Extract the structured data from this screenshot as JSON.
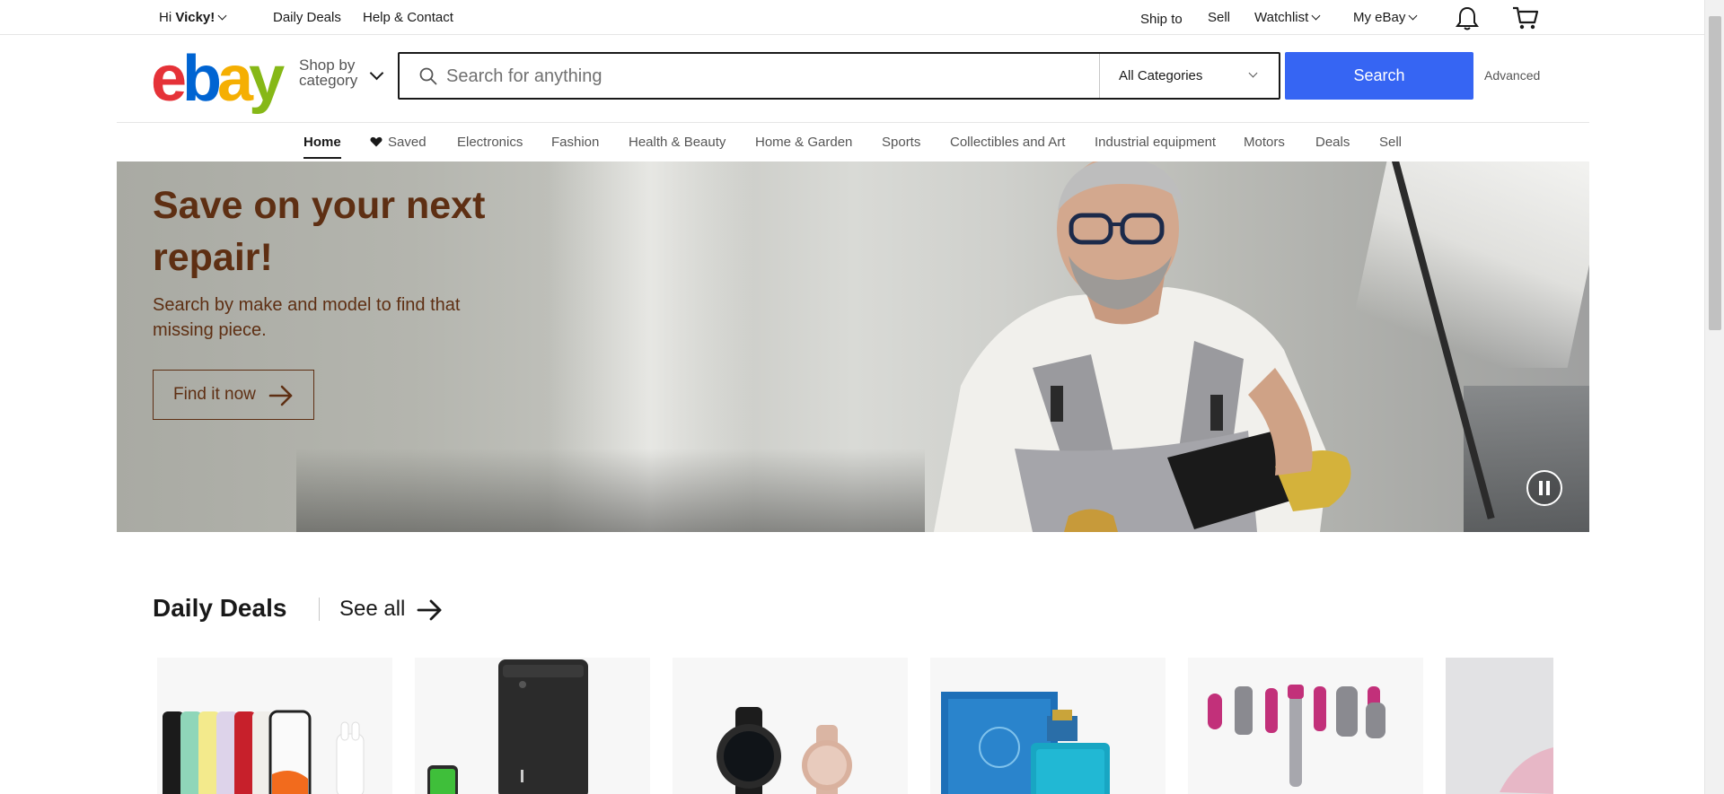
{
  "topbar": {
    "greeting_prefix": "Hi ",
    "user_name": "Vicky!",
    "daily_deals": "Daily Deals",
    "help_contact": "Help & Contact",
    "ship_to": "Ship to",
    "sell": "Sell",
    "watchlist": "Watchlist",
    "my_ebay": "My eBay"
  },
  "header": {
    "logo": {
      "e": "e",
      "b": "b",
      "a": "a",
      "y": "y"
    },
    "shop_by_line1": "Shop by",
    "shop_by_line2": "category",
    "search_placeholder": "Search for anything",
    "category_selected": "All Categories",
    "search_button": "Search",
    "advanced": "Advanced"
  },
  "nav": {
    "items": [
      "Home",
      "Saved",
      "Electronics",
      "Fashion",
      "Health & Beauty",
      "Home & Garden",
      "Sports",
      "Collectibles and Art",
      "Industrial equipment",
      "Motors",
      "Deals",
      "Sell"
    ]
  },
  "hero": {
    "title": "Save on your next repair!",
    "subtitle": "Search by make and model to find that missing piece.",
    "cta": "Find it now"
  },
  "daily_deals": {
    "title": "Daily Deals",
    "see_all": "See all"
  },
  "colors": {
    "accent_blue": "#3665f3",
    "hero_text": "#5e2f13",
    "logo_red": "#e53238",
    "logo_blue": "#0064d2",
    "logo_yellow": "#f5af02",
    "logo_green": "#86b817"
  }
}
